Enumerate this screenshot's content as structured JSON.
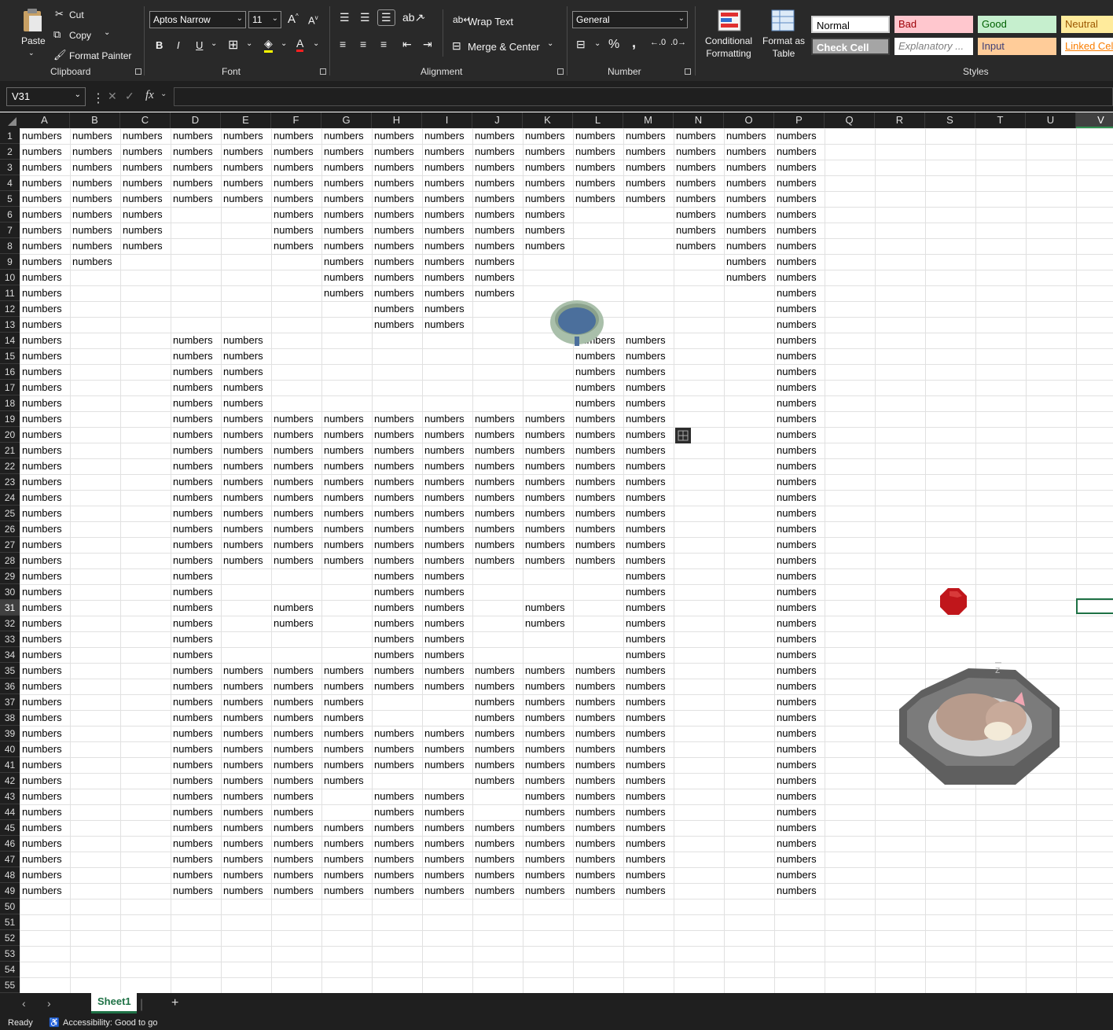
{
  "ribbon": {
    "clipboard": {
      "paste": "Paste",
      "cut": "Cut",
      "copy": "Copy",
      "format_painter": "Format Painter",
      "group": "Clipboard"
    },
    "font": {
      "name": "Aptos Narrow",
      "size": "11",
      "bold": "B",
      "italic": "I",
      "underline": "U",
      "group": "Font"
    },
    "alignment": {
      "wrap_text": "Wrap Text",
      "merge_center": "Merge & Center",
      "group": "Alignment"
    },
    "number": {
      "format": "General",
      "percent": "%",
      "comma": ",",
      "group": "Number"
    },
    "styles": {
      "conditional_formatting": "Conditional\nFormatting",
      "format_as_table": "Format as\nTable",
      "group": "Styles",
      "cells": [
        {
          "label": "Normal",
          "bg": "#ffffff",
          "fg": "#000000"
        },
        {
          "label": "Bad",
          "bg": "#ffc7ce",
          "fg": "#9c0006"
        },
        {
          "label": "Good",
          "bg": "#c6efce",
          "fg": "#006100"
        },
        {
          "label": "Neutral",
          "bg": "#ffeb9c",
          "fg": "#9c5700"
        },
        {
          "label": "Check Cell",
          "bg": "#a5a5a5",
          "fg": "#ffffff"
        },
        {
          "label": "Explanatory ...",
          "bg": "#ffffff",
          "fg": "#7f7f7f"
        },
        {
          "label": "Input",
          "bg": "#ffcc99",
          "fg": "#3f3f76"
        },
        {
          "label": "Linked Cell",
          "bg": "#ffffff",
          "fg": "#fa7d00"
        }
      ]
    }
  },
  "formula_bar": {
    "name_box": "V31",
    "fx": "fx",
    "formula": ""
  },
  "columns": [
    "A",
    "B",
    "C",
    "D",
    "E",
    "F",
    "G",
    "H",
    "I",
    "J",
    "K",
    "L",
    "M",
    "N",
    "O",
    "P",
    "Q",
    "R",
    "S",
    "T",
    "U",
    "V"
  ],
  "selected_column": "V",
  "selected_row": 31,
  "row_count": 55,
  "cell_text": "numbers",
  "filled": {
    "1": "ABCDEFGHIJKLMNOP",
    "2": "ABCDEFGHIJKLMNOP",
    "3": "ABCDEFGHIJKLMNOP",
    "4": "ABCDEFGHIJKLMNOP",
    "5": "ABCDEFGHIJKLMNOP",
    "6": "ABCFGHIJKNOP",
    "7": "ABCFGHIJKNOP",
    "8": "ABCFGHIJKNOP",
    "9": "ABGHIJOP",
    "10": "AGHIJOP",
    "11": "AGHIJP",
    "12": "AHIP",
    "13": "AHIP",
    "14": "ADELMP",
    "15": "ADELMP",
    "16": "ADELMP",
    "17": "ADELMP",
    "18": "ADELMP",
    "19": "ADEFGHIJKLMP",
    "20": "ADEFGHIJKLMP",
    "21": "ADEFGHIJKLMP",
    "22": "ADEFGHIJKLMP",
    "23": "ADEFGHIJKLMP",
    "24": "ADEFGHIJKLMP",
    "25": "ADEFGHIJKLMP",
    "26": "ADEFGHIJKLMP",
    "27": "ADEFGHIJKLMP",
    "28": "ADEFGHIJKLMP",
    "29": "ADHIMP",
    "30": "ADHIMP",
    "31": "ADFHIKMP",
    "32": "ADFHIKMP",
    "33": "ADHIMP",
    "34": "ADHIMP",
    "35": "ADEFGHIJKLMP",
    "36": "ADEFGHIJKLMP",
    "37": "ADEFGJKLMP",
    "38": "ADEFGJKLMP",
    "39": "ADEFGHIJKLMP",
    "40": "ADEFGHIJKLMP",
    "41": "ADEFGHIJKLMP",
    "42": "ADEFGJKLMP",
    "43": "ADEFHIKLMP",
    "44": "ADEFHIKLMP",
    "45": "ADEFGHIJKLMP",
    "46": "ADEFGHIJKLMP",
    "47": "ADEFGHIJKLMP",
    "48": "ADEFGHIJKLMP",
    "49": "ADEFGHIJKLMP"
  },
  "sheet_tabs": [
    {
      "label": "Sheet1",
      "active": true
    }
  ],
  "status": {
    "ready": "Ready",
    "accessibility": "Accessibility: Good to go"
  }
}
